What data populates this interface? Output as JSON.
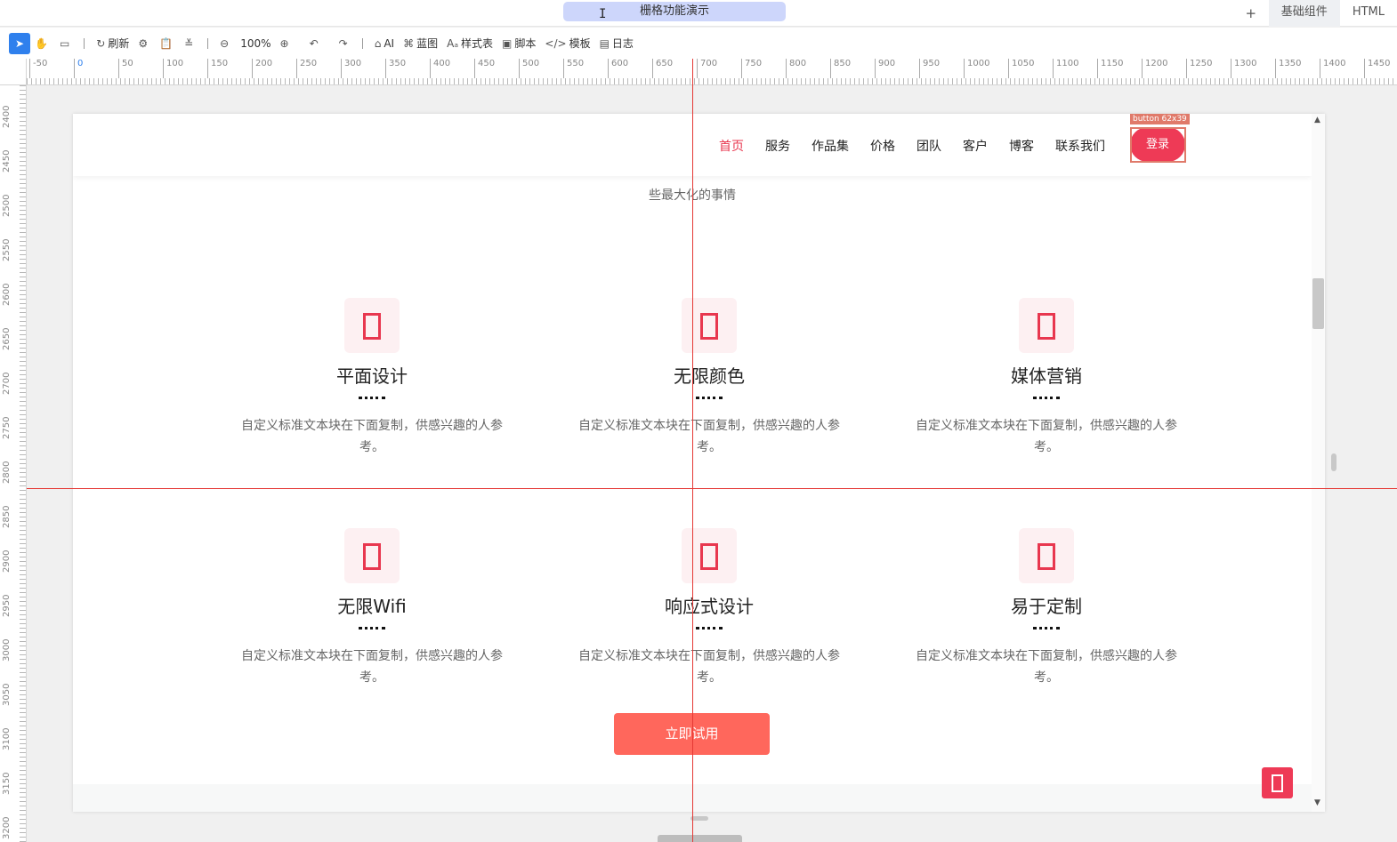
{
  "titlebar": {
    "doc_title": "栅格功能演示",
    "plus": "+",
    "tabs": [
      {
        "label": "基础组件"
      },
      {
        "label": "HTML"
      }
    ]
  },
  "toolbar": {
    "refresh": "刷新",
    "zoom": "100%",
    "ai": "AI",
    "blueprint": "蓝图",
    "stylesheet": "样式表",
    "script": "脚本",
    "template": "模板",
    "log": "日志"
  },
  "ruler": {
    "top": [
      "-50",
      "0",
      "50",
      "100",
      "150",
      "200",
      "250",
      "300",
      "350",
      "400",
      "450",
      "500",
      "550",
      "600",
      "650",
      "700",
      "750",
      "800",
      "850",
      "900",
      "950",
      "1000",
      "1050",
      "1100",
      "1150",
      "1200",
      "1250",
      "1300",
      "1350",
      "1400",
      "1450"
    ],
    "left": [
      "2400",
      "2450",
      "2500",
      "2550",
      "2600",
      "2650",
      "2700",
      "2750",
      "2800",
      "2850",
      "2900",
      "2950",
      "3000",
      "3050",
      "3100",
      "3150",
      "3200"
    ]
  },
  "page": {
    "nav": [
      "首页",
      "服务",
      "作品集",
      "价格",
      "团队",
      "客户",
      "博客",
      "联系我们"
    ],
    "login": "登录",
    "selection_tag": "button 62x39",
    "subtitle": "些最大化的事情",
    "features": [
      {
        "title": "平面设计",
        "desc": "自定义标准文本块在下面复制，供感兴趣的人参考。"
      },
      {
        "title": "无限颜色",
        "desc": "自定义标准文本块在下面复制，供感兴趣的人参考。"
      },
      {
        "title": "媒体营销",
        "desc": "自定义标准文本块在下面复制，供感兴趣的人参考。"
      },
      {
        "title": "无限Wifi",
        "desc": "自定义标准文本块在下面复制，供感兴趣的人参考。"
      },
      {
        "title": "响应式设计",
        "desc": "自定义标准文本块在下面复制，供感兴趣的人参考。"
      },
      {
        "title": "易于定制",
        "desc": "自定义标准文本块在下面复制，供感兴趣的人参考。"
      }
    ],
    "cta": "立即试用"
  },
  "colors": {
    "accent": "#e8374f",
    "cta": "#ff675c",
    "guide": "#e53935",
    "toolbar_active": "#2f80ed"
  }
}
